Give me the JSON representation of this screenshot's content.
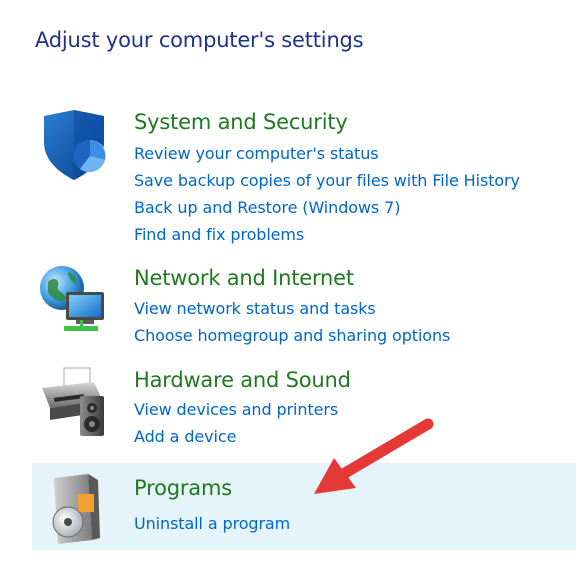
{
  "page": {
    "title": "Adjust your computer's settings"
  },
  "categories": [
    {
      "title": "System and Security",
      "icon": "shield-icon",
      "links": [
        "Review your computer's status",
        "Save backup copies of your files with File History",
        "Back up and Restore (Windows 7)",
        "Find and fix problems"
      ]
    },
    {
      "title": "Network and Internet",
      "icon": "network-icon",
      "links": [
        "View network status and tasks",
        "Choose homegroup and sharing options"
      ]
    },
    {
      "title": "Hardware and Sound",
      "icon": "printer-icon",
      "links": [
        "View devices and printers",
        "Add a device"
      ]
    },
    {
      "title": "Programs",
      "icon": "programs-icon",
      "links": [
        "Uninstall a program"
      ]
    }
  ],
  "colors": {
    "title": "#1e3287",
    "category": "#1e7a1e",
    "link": "#0066cc",
    "highlight": "#e5f3fb",
    "arrow": "#e53935"
  }
}
